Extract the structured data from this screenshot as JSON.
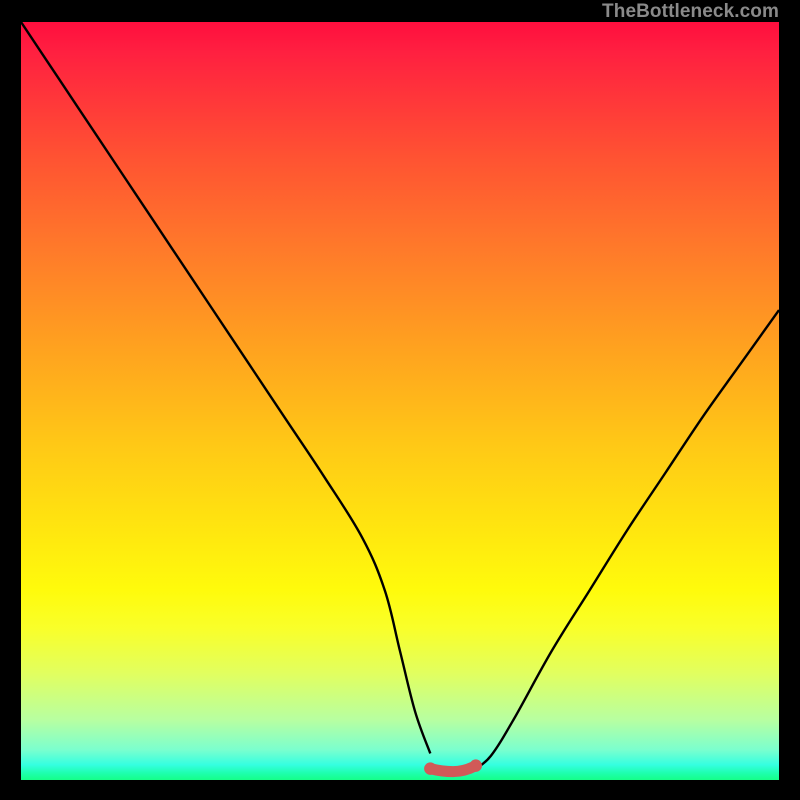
{
  "watermark": "TheBottleneck.com",
  "chart_data": {
    "type": "line",
    "title": "",
    "xlabel": "",
    "ylabel": "",
    "xlim": [
      0,
      100
    ],
    "ylim": [
      0,
      100
    ],
    "series": [
      {
        "name": "bottleneck_curve",
        "x": [
          0,
          5,
          10,
          15,
          20,
          25,
          30,
          35,
          40,
          45,
          48,
          50,
          52,
          54,
          56,
          58,
          60,
          62,
          65,
          70,
          75,
          80,
          85,
          90,
          95,
          100
        ],
        "values": [
          100,
          92.5,
          85,
          77.5,
          70,
          62.5,
          55,
          47.5,
          40,
          32,
          25,
          17,
          9,
          3.5,
          1.5,
          1.5,
          1.5,
          3.2,
          8,
          17,
          25,
          33,
          40.5,
          48,
          55,
          62
        ]
      }
    ],
    "flat_segment": {
      "x_start": 54,
      "x_end": 60,
      "y": 1.5
    },
    "background_gradient": {
      "top": "#ff0e3e",
      "mid": "#ffe60f",
      "bottom": "#15ff88"
    },
    "curve_color": "#000000",
    "flat_marker_color": "#d15a58"
  }
}
